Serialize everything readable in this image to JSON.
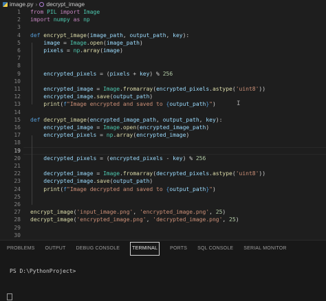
{
  "breadcrumb": {
    "file": "image.py",
    "symbol": "decrypt_image"
  },
  "editor": {
    "line_numbers": [
      "1",
      "2",
      "3",
      "4",
      "5",
      "6",
      "7",
      "8",
      "9",
      "10",
      "11",
      "12",
      "13",
      "14",
      "15",
      "16",
      "17",
      "18",
      "19",
      "20",
      "21",
      "22",
      "23",
      "24",
      "25",
      "26",
      "27",
      "28",
      "29",
      "30"
    ],
    "active_line": "19",
    "lines": [
      [
        {
          "t": "from ",
          "c": "kw"
        },
        {
          "t": "PIL ",
          "c": "mod"
        },
        {
          "t": "import ",
          "c": "kw"
        },
        {
          "t": "Image",
          "c": "cls"
        }
      ],
      [
        {
          "t": "import ",
          "c": "kw"
        },
        {
          "t": "numpy ",
          "c": "mod"
        },
        {
          "t": "as ",
          "c": "kw"
        },
        {
          "t": "np",
          "c": "mod"
        }
      ],
      [],
      [
        {
          "t": "def ",
          "c": "def"
        },
        {
          "t": "encrypt_image",
          "c": "fn"
        },
        {
          "t": "(",
          "c": "p"
        },
        {
          "t": "image_path",
          "c": "var"
        },
        {
          "t": ", ",
          "c": "p"
        },
        {
          "t": "output_path",
          "c": "var"
        },
        {
          "t": ", ",
          "c": "p"
        },
        {
          "t": "key",
          "c": "var"
        },
        {
          "t": "):",
          "c": "p"
        }
      ],
      [
        {
          "t": "    image ",
          "c": "var"
        },
        {
          "t": "= ",
          "c": "p"
        },
        {
          "t": "Image",
          "c": "cls"
        },
        {
          "t": ".",
          "c": "p"
        },
        {
          "t": "open",
          "c": "fn"
        },
        {
          "t": "(",
          "c": "p"
        },
        {
          "t": "image_path",
          "c": "var"
        },
        {
          "t": ")",
          "c": "p"
        }
      ],
      [
        {
          "t": "    pixels ",
          "c": "var"
        },
        {
          "t": "= ",
          "c": "p"
        },
        {
          "t": "np",
          "c": "mod"
        },
        {
          "t": ".",
          "c": "p"
        },
        {
          "t": "array",
          "c": "fn"
        },
        {
          "t": "(",
          "c": "p"
        },
        {
          "t": "image",
          "c": "var"
        },
        {
          "t": ")",
          "c": "p"
        }
      ],
      [],
      [],
      [
        {
          "t": "    encrypted_pixels ",
          "c": "var"
        },
        {
          "t": "= (",
          "c": "p"
        },
        {
          "t": "pixels ",
          "c": "var"
        },
        {
          "t": "+ ",
          "c": "p"
        },
        {
          "t": "key",
          "c": "var"
        },
        {
          "t": ") % ",
          "c": "p"
        },
        {
          "t": "256",
          "c": "num"
        }
      ],
      [],
      [
        {
          "t": "    encrypted_image ",
          "c": "var"
        },
        {
          "t": "= ",
          "c": "p"
        },
        {
          "t": "Image",
          "c": "cls"
        },
        {
          "t": ".",
          "c": "p"
        },
        {
          "t": "fromarray",
          "c": "fn"
        },
        {
          "t": "(",
          "c": "p"
        },
        {
          "t": "encrypted_pixels",
          "c": "var"
        },
        {
          "t": ".",
          "c": "p"
        },
        {
          "t": "astype",
          "c": "fn"
        },
        {
          "t": "(",
          "c": "p"
        },
        {
          "t": "'uint8'",
          "c": "str"
        },
        {
          "t": "))",
          "c": "p"
        }
      ],
      [
        {
          "t": "    encrypted_image",
          "c": "var"
        },
        {
          "t": ".",
          "c": "p"
        },
        {
          "t": "save",
          "c": "fn"
        },
        {
          "t": "(",
          "c": "p"
        },
        {
          "t": "output_path",
          "c": "var"
        },
        {
          "t": ")",
          "c": "p"
        }
      ],
      [
        {
          "t": "    print",
          "c": "fn"
        },
        {
          "t": "(",
          "c": "p"
        },
        {
          "t": "f",
          "c": "def"
        },
        {
          "t": "\"Image encrypted and saved to ",
          "c": "str"
        },
        {
          "t": "{",
          "c": "def"
        },
        {
          "t": "output_path",
          "c": "var"
        },
        {
          "t": "}",
          "c": "def"
        },
        {
          "t": "\"",
          "c": "str"
        },
        {
          "t": ")",
          "c": "p"
        }
      ],
      [],
      [
        {
          "t": "def ",
          "c": "def"
        },
        {
          "t": "decrypt_image",
          "c": "fn"
        },
        {
          "t": "(",
          "c": "p"
        },
        {
          "t": "encrypted_image_path",
          "c": "var"
        },
        {
          "t": ", ",
          "c": "p"
        },
        {
          "t": "output_path",
          "c": "var"
        },
        {
          "t": ", ",
          "c": "p"
        },
        {
          "t": "key",
          "c": "var"
        },
        {
          "t": "):",
          "c": "p"
        }
      ],
      [
        {
          "t": "    encrypted_image ",
          "c": "var"
        },
        {
          "t": "= ",
          "c": "p"
        },
        {
          "t": "Image",
          "c": "cls"
        },
        {
          "t": ".",
          "c": "p"
        },
        {
          "t": "open",
          "c": "fn"
        },
        {
          "t": "(",
          "c": "p"
        },
        {
          "t": "encrypted_image_path",
          "c": "var"
        },
        {
          "t": ")",
          "c": "p"
        }
      ],
      [
        {
          "t": "    encrypted_pixels ",
          "c": "var"
        },
        {
          "t": "= ",
          "c": "p"
        },
        {
          "t": "np",
          "c": "mod"
        },
        {
          "t": ".",
          "c": "p"
        },
        {
          "t": "array",
          "c": "fn"
        },
        {
          "t": "(",
          "c": "p"
        },
        {
          "t": "encrypted_image",
          "c": "var"
        },
        {
          "t": ")",
          "c": "p"
        }
      ],
      [],
      [],
      [
        {
          "t": "    decrypted_pixels ",
          "c": "var"
        },
        {
          "t": "= (",
          "c": "p"
        },
        {
          "t": "encrypted_pixels ",
          "c": "var"
        },
        {
          "t": "- ",
          "c": "p"
        },
        {
          "t": "key",
          "c": "var"
        },
        {
          "t": ") % ",
          "c": "p"
        },
        {
          "t": "256",
          "c": "num"
        }
      ],
      [],
      [
        {
          "t": "    decrypted_image ",
          "c": "var"
        },
        {
          "t": "= ",
          "c": "p"
        },
        {
          "t": "Image",
          "c": "cls"
        },
        {
          "t": ".",
          "c": "p"
        },
        {
          "t": "fromarray",
          "c": "fn"
        },
        {
          "t": "(",
          "c": "p"
        },
        {
          "t": "decrypted_pixels",
          "c": "var"
        },
        {
          "t": ".",
          "c": "p"
        },
        {
          "t": "astype",
          "c": "fn"
        },
        {
          "t": "(",
          "c": "p"
        },
        {
          "t": "'uint8'",
          "c": "str"
        },
        {
          "t": "))",
          "c": "p"
        }
      ],
      [
        {
          "t": "    decrypted_image",
          "c": "var"
        },
        {
          "t": ".",
          "c": "p"
        },
        {
          "t": "save",
          "c": "fn"
        },
        {
          "t": "(",
          "c": "p"
        },
        {
          "t": "output_path",
          "c": "var"
        },
        {
          "t": ")",
          "c": "p"
        }
      ],
      [
        {
          "t": "    print",
          "c": "fn"
        },
        {
          "t": "(",
          "c": "p"
        },
        {
          "t": "f",
          "c": "def"
        },
        {
          "t": "\"Image decrypted and saved to ",
          "c": "str"
        },
        {
          "t": "{",
          "c": "def"
        },
        {
          "t": "output_path",
          "c": "var"
        },
        {
          "t": "}",
          "c": "def"
        },
        {
          "t": "\"",
          "c": "str"
        },
        {
          "t": ")",
          "c": "p"
        }
      ],
      [],
      [],
      [
        {
          "t": "encrypt_image",
          "c": "fn"
        },
        {
          "t": "(",
          "c": "p"
        },
        {
          "t": "'input_image.png'",
          "c": "str"
        },
        {
          "t": ", ",
          "c": "p"
        },
        {
          "t": "'encrypted_image.png'",
          "c": "str"
        },
        {
          "t": ", ",
          "c": "p"
        },
        {
          "t": "25",
          "c": "num"
        },
        {
          "t": ")",
          "c": "p"
        }
      ],
      [
        {
          "t": "decrypt_image",
          "c": "fn"
        },
        {
          "t": "(",
          "c": "p"
        },
        {
          "t": "'encrypted_image.png'",
          "c": "str"
        },
        {
          "t": ", ",
          "c": "p"
        },
        {
          "t": "'decrypted_image.png'",
          "c": "str"
        },
        {
          "t": ", ",
          "c": "p"
        },
        {
          "t": "25",
          "c": "num"
        },
        {
          "t": ")",
          "c": "p"
        }
      ],
      [],
      []
    ]
  },
  "panel": {
    "tabs": [
      "PROBLEMS",
      "OUTPUT",
      "DEBUG CONSOLE",
      "TERMINAL",
      "PORTS",
      "SQL CONSOLE",
      "SERIAL MONITOR"
    ],
    "active_tab": "TERMINAL",
    "prompt": "PS D:\\PythonProject>"
  },
  "colors": {
    "background": "#1e1e1e",
    "keyword": "#c586c0",
    "function": "#dcdcaa",
    "variable": "#9cdcfe",
    "class": "#4ec9b0",
    "string": "#ce9178",
    "number": "#b5cea8"
  },
  "icons": {
    "file": "python-file-icon",
    "symbol": "function-symbol-icon"
  }
}
